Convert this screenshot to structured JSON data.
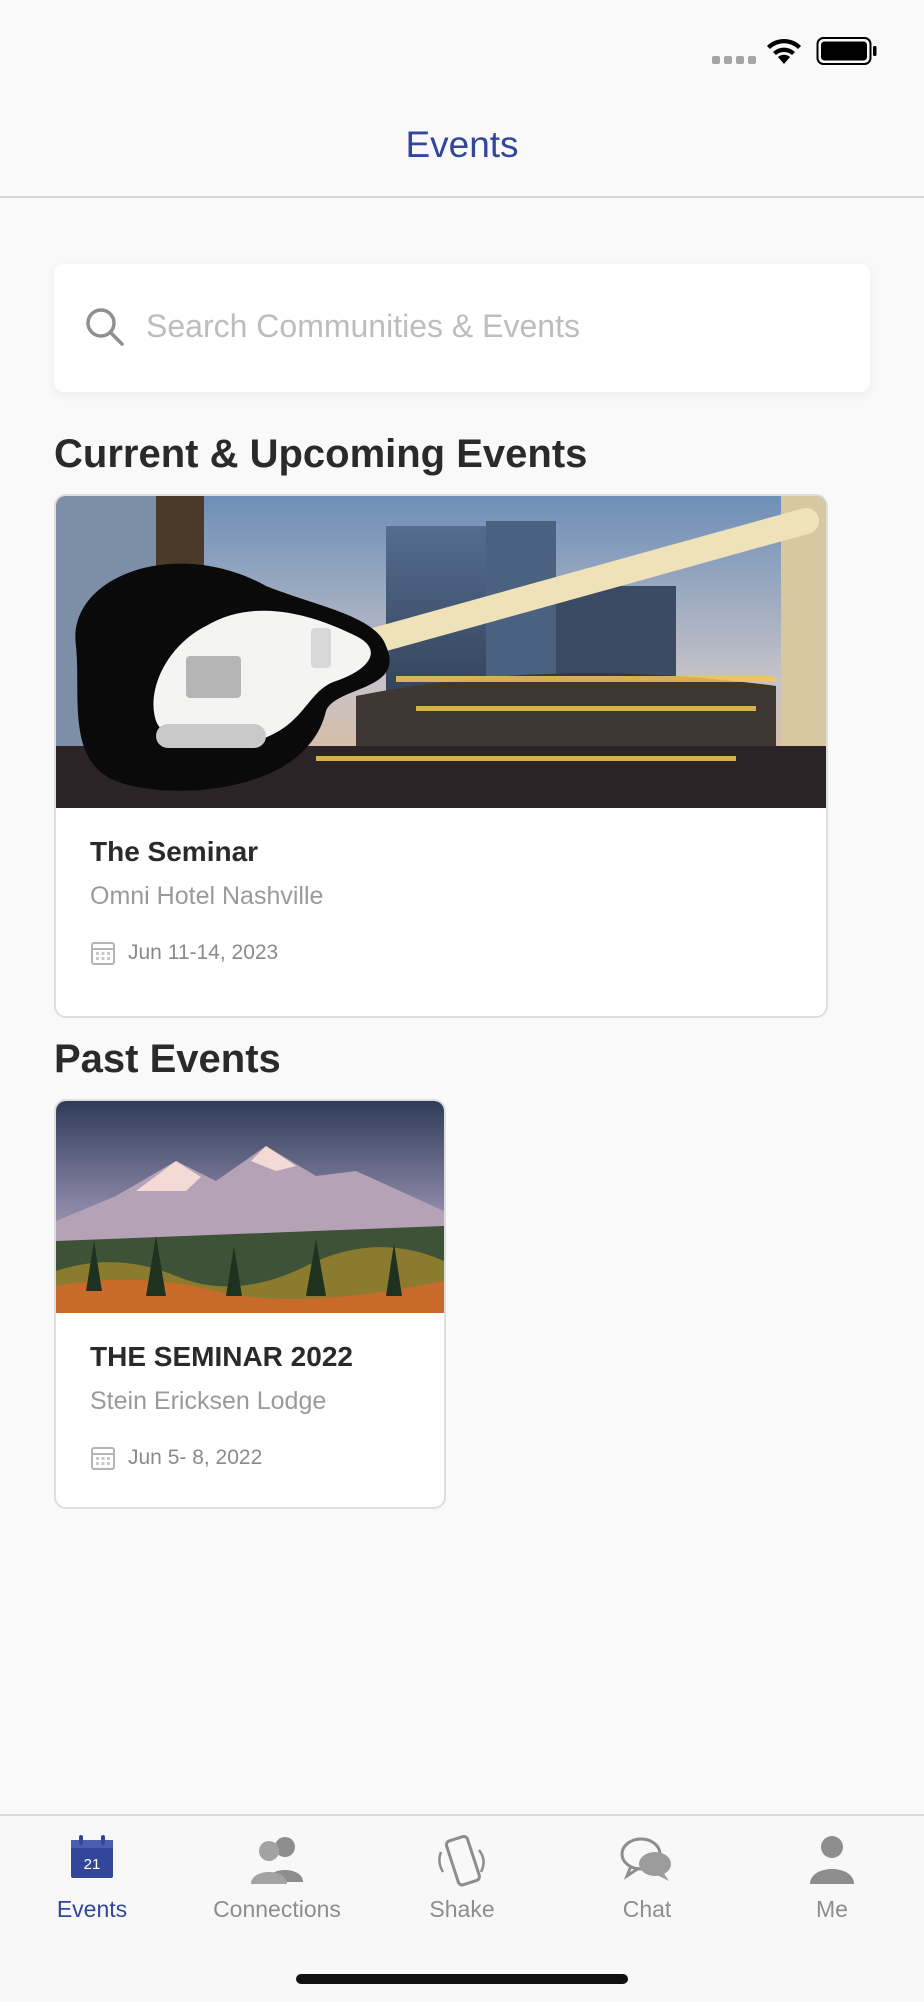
{
  "nav": {
    "title": "Events"
  },
  "search": {
    "placeholder": "Search Communities & Events"
  },
  "sections": {
    "current_heading": "Current & Upcoming Events",
    "past_heading": "Past Events"
  },
  "current_events": [
    {
      "title": "The Seminar",
      "venue": "Omni Hotel Nashville",
      "dates": "Jun 11-14, 2023"
    }
  ],
  "past_events": [
    {
      "title": "THE SEMINAR 2022",
      "venue": "Stein Ericksen Lodge",
      "dates": "Jun  5- 8, 2022"
    }
  ],
  "tabs": [
    {
      "label": "Events",
      "icon": "calendar-icon",
      "badge": "21",
      "active": true
    },
    {
      "label": "Connections",
      "icon": "people-icon",
      "active": false
    },
    {
      "label": "Shake",
      "icon": "shake-phone-icon",
      "active": false
    },
    {
      "label": "Chat",
      "icon": "chat-bubbles-icon",
      "active": false
    },
    {
      "label": "Me",
      "icon": "person-icon",
      "active": false
    }
  ],
  "colors": {
    "accent": "#33479a",
    "inactive": "#8d8d8d",
    "background": "#faf9fa"
  }
}
